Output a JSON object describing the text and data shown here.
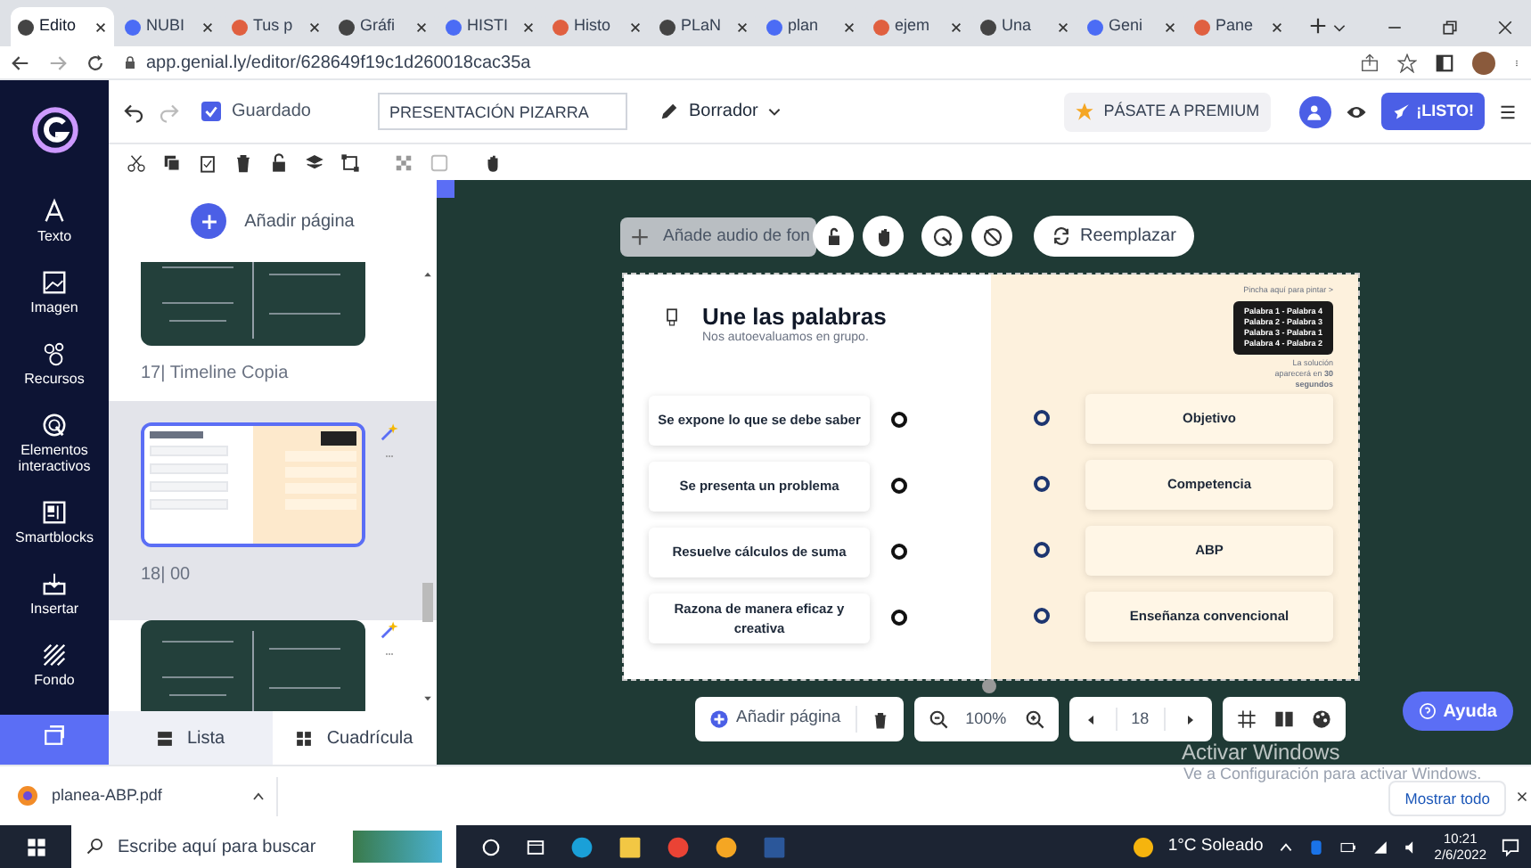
{
  "browser": {
    "tabs": [
      {
        "label": "Edito",
        "selected": true
      },
      {
        "label": "NUBI",
        "selected": false
      },
      {
        "label": "Tus p",
        "selected": false
      },
      {
        "label": "Gráfi",
        "selected": false
      },
      {
        "label": "HISTI",
        "selected": false
      },
      {
        "label": "Histo",
        "selected": false
      },
      {
        "label": "PLaN",
        "selected": false
      },
      {
        "label": "plan",
        "selected": false
      },
      {
        "label": "ejem",
        "selected": false
      },
      {
        "label": "Una",
        "selected": false
      },
      {
        "label": "Geni",
        "selected": false
      },
      {
        "label": "Pane",
        "selected": false
      }
    ],
    "url": "app.genial.ly/editor/628649f19c1d260018cac35a"
  },
  "toolbar": {
    "saved": {
      "label": "Guardado",
      "checked": true
    },
    "title_field": "PRESENTACIÓN PIZARRA",
    "status": "Borrador",
    "premium": "PÁSATE A PREMIUM",
    "ready": "¡LISTO!"
  },
  "sidebar": {
    "items": [
      {
        "label": "Texto",
        "selected": false
      },
      {
        "label": "Imagen",
        "selected": false
      },
      {
        "label": "Recursos",
        "selected": false
      },
      {
        "label": "Elementos interactivos",
        "selected": false
      },
      {
        "label": "Smartblocks",
        "selected": false
      },
      {
        "label": "Insertar",
        "selected": false
      },
      {
        "label": "Fondo",
        "selected": false
      }
    ],
    "pages_button": {
      "selected": true
    }
  },
  "pages_panel": {
    "add_page": "Añadir página",
    "pages": [
      {
        "kind": "chalkboard",
        "caption": "17| Timeline Copia",
        "selected": false
      },
      {
        "kind": "match",
        "caption": "18| 00",
        "selected": true
      },
      {
        "kind": "chalkboard",
        "selected": false
      }
    ],
    "views": [
      {
        "label": "Lista",
        "selected": true
      },
      {
        "label": "Cuadrícula",
        "selected": false
      }
    ]
  },
  "canvas": {
    "audio_placeholder": "Añade audio de fon",
    "replace": "Reemplazar",
    "slide": {
      "title": "Une las palabras",
      "subtitle": "Nos autoevaluamos en grupo.",
      "hint": "Pincha aquí para pintar >",
      "answers": [
        "Palabra 1 - Palabra 4",
        "Palabra 2 - Palabra 3",
        "Palabra 3 - Palabra 1",
        "Palabra 4 - Palabra 2"
      ],
      "note": "La solución aparecerá en **30 segundos**",
      "left_items": [
        "Se expone lo que se debe saber",
        "Se presenta un problema",
        "Resuelve cálculos de suma",
        "Razona de manera eficaz y creativa"
      ],
      "right_items": [
        "Objetivo",
        "Competencia",
        "ABP",
        "Enseñanza convencional"
      ]
    },
    "bottom_bar": {
      "add_page": "Añadir página",
      "zoom": "100%",
      "page": "18"
    },
    "help": "Ayuda"
  },
  "windows_notice": {
    "title": "Activar Windows",
    "text": "Ve a Configuración para activar Windows."
  },
  "download_bar": {
    "file": "planea-ABP.pdf",
    "show_all": "Mostrar todo"
  },
  "taskbar": {
    "search_placeholder": "Escribe aquí para buscar",
    "weather": "1°C Soleado",
    "time": "10:21",
    "date": "2/6/2022"
  }
}
